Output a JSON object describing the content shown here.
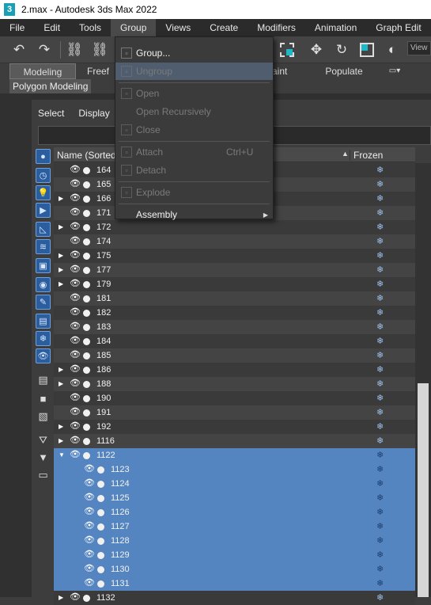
{
  "window": {
    "title": "2.max - Autodesk 3ds Max 2022",
    "app_icon": "3"
  },
  "menubar": {
    "items": [
      "File",
      "Edit",
      "Tools",
      "Group",
      "Views",
      "Create",
      "Modifiers",
      "Animation",
      "Graph Edit"
    ],
    "active": "Group"
  },
  "toolbar": {
    "view_label": "View"
  },
  "ribbon": {
    "tabs": [
      {
        "label": "Modeling",
        "selected": true
      },
      {
        "label": "Freef"
      },
      {
        "label": "aint"
      },
      {
        "label": "Populate"
      }
    ]
  },
  "subbar": {
    "label": "Polygon Modeling"
  },
  "explorer": {
    "menu": [
      "Select",
      "Display"
    ],
    "columns": {
      "name": "Name (Sorted A",
      "frozen": "Frozen"
    },
    "rows": [
      {
        "name": "164",
        "arrow": false,
        "sel": false,
        "indent": 0
      },
      {
        "name": "165",
        "arrow": false,
        "sel": false,
        "indent": 0
      },
      {
        "name": "166",
        "arrow": true,
        "sel": false,
        "indent": 0
      },
      {
        "name": "171",
        "arrow": false,
        "sel": false,
        "indent": 0
      },
      {
        "name": "172",
        "arrow": true,
        "sel": false,
        "indent": 0
      },
      {
        "name": "174",
        "arrow": false,
        "sel": false,
        "indent": 0
      },
      {
        "name": "175",
        "arrow": true,
        "sel": false,
        "indent": 0
      },
      {
        "name": "177",
        "arrow": true,
        "sel": false,
        "indent": 0
      },
      {
        "name": "179",
        "arrow": true,
        "sel": false,
        "indent": 0
      },
      {
        "name": "181",
        "arrow": false,
        "sel": false,
        "indent": 0
      },
      {
        "name": "182",
        "arrow": false,
        "sel": false,
        "indent": 0
      },
      {
        "name": "183",
        "arrow": false,
        "sel": false,
        "indent": 0
      },
      {
        "name": "184",
        "arrow": false,
        "sel": false,
        "indent": 0
      },
      {
        "name": "185",
        "arrow": false,
        "sel": false,
        "indent": 0
      },
      {
        "name": "186",
        "arrow": true,
        "sel": false,
        "indent": 0
      },
      {
        "name": "188",
        "arrow": true,
        "sel": false,
        "indent": 0
      },
      {
        "name": "190",
        "arrow": false,
        "sel": false,
        "indent": 0
      },
      {
        "name": "191",
        "arrow": false,
        "sel": false,
        "indent": 0
      },
      {
        "name": "192",
        "arrow": true,
        "sel": false,
        "indent": 0
      },
      {
        "name": "1116",
        "arrow": true,
        "sel": false,
        "indent": 0
      },
      {
        "name": "1122",
        "arrow": "down",
        "sel": true,
        "indent": 0
      },
      {
        "name": "1123",
        "arrow": false,
        "sel": true,
        "indent": 1
      },
      {
        "name": "1124",
        "arrow": false,
        "sel": true,
        "indent": 1
      },
      {
        "name": "1125",
        "arrow": false,
        "sel": true,
        "indent": 1
      },
      {
        "name": "1126",
        "arrow": false,
        "sel": true,
        "indent": 1
      },
      {
        "name": "1127",
        "arrow": false,
        "sel": true,
        "indent": 1
      },
      {
        "name": "1128",
        "arrow": false,
        "sel": true,
        "indent": 1
      },
      {
        "name": "1129",
        "arrow": false,
        "sel": true,
        "indent": 1
      },
      {
        "name": "1130",
        "arrow": false,
        "sel": true,
        "indent": 1
      },
      {
        "name": "1131",
        "arrow": false,
        "sel": true,
        "indent": 1
      },
      {
        "name": "1132",
        "arrow": true,
        "sel": false,
        "indent": 0
      }
    ],
    "frozen_glyph": "❄"
  },
  "group_menu": {
    "items": [
      {
        "label": "Group...",
        "enabled": true,
        "icon": "group-icon"
      },
      {
        "label": "Ungroup",
        "enabled": false,
        "icon": "ungroup-icon",
        "hover": true
      },
      {
        "sep": true
      },
      {
        "label": "Open",
        "enabled": false,
        "icon": "open-group-icon"
      },
      {
        "label": "Open Recursively",
        "enabled": false,
        "icon": ""
      },
      {
        "label": "Close",
        "enabled": false,
        "icon": "close-group-icon"
      },
      {
        "sep": true
      },
      {
        "label": "Attach",
        "enabled": false,
        "icon": "attach-icon",
        "shortcut": "Ctrl+U"
      },
      {
        "label": "Detach",
        "enabled": false,
        "icon": "detach-icon"
      },
      {
        "sep": true
      },
      {
        "label": "Explode",
        "enabled": false,
        "icon": "explode-icon"
      },
      {
        "sep": true
      },
      {
        "label": "Assembly",
        "enabled": true,
        "icon": "",
        "submenu": true
      }
    ]
  },
  "colors": {
    "selection": "#5585c0",
    "accent": "#1fb8c8"
  }
}
